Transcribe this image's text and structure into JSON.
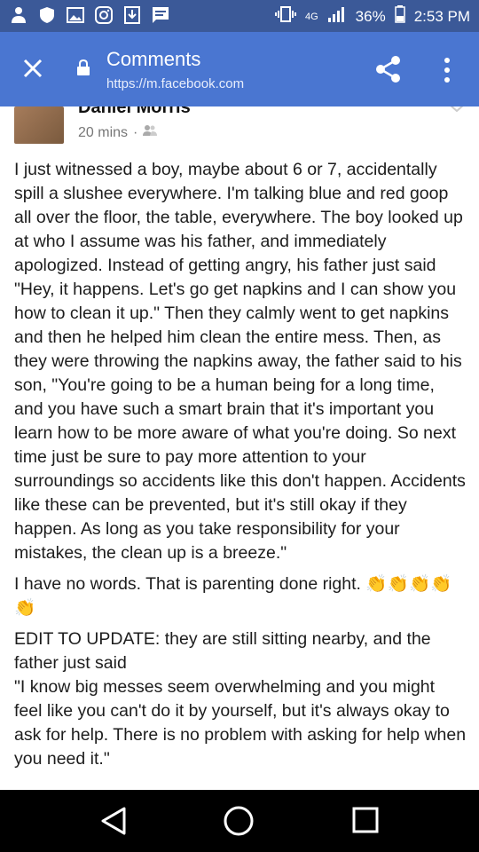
{
  "status_bar": {
    "network": "4G",
    "battery": "36%",
    "time": "2:53 PM"
  },
  "app_bar": {
    "title": "Comments",
    "url": "https://m.facebook.com"
  },
  "post": {
    "author": "Daniel Morris",
    "time": "20 mins",
    "separator": "·",
    "paragraphs": [
      "I just witnessed a boy, maybe about 6 or 7, accidentally spill a slushee everywhere. I'm talking blue and red goop all over the floor, the table, everywhere. The boy looked up at who I assume was his father, and immediately apologized. Instead of getting angry, his father just said \"Hey, it happens. Let's go get napkins and I can show you how to clean it up.\" Then they calmly went to get napkins and then he helped him clean the entire mess. Then, as they were throwing the napkins away, the father said to his son, \"You're going to be a human being for a long time, and you have such a smart brain that it's important you learn how to be more aware of what you're doing. So next time just be sure to pay more attention to your surroundings so accidents like this don't happen. Accidents like these can be prevented, but it's still okay if they happen. As long as you take responsibility for your mistakes, the clean up is a breeze.\"",
      "I have no words. That is parenting done right. 👏👏👏👏👏",
      "EDIT TO UPDATE: they are still sitting nearby, and the father just said",
      "\"I know big messes seem overwhelming and you might feel like you can't do it by yourself, but it's always okay to ask for help. There is no problem with asking for help when you need it.\""
    ]
  },
  "icons": [
    "person-icon",
    "shield-icon",
    "image-icon",
    "instagram-icon",
    "download-icon",
    "message-icon",
    "vibrate-icon",
    "signal-icon",
    "battery-icon",
    "close-icon",
    "lock-icon",
    "share-icon",
    "more-icon",
    "friends-icon",
    "chevron-down-icon",
    "back-icon",
    "home-icon",
    "recent-apps-icon"
  ],
  "colors": {
    "status_bar": "#3b5998",
    "app_bar": "#4a76d1",
    "nav_bar": "#000000"
  }
}
